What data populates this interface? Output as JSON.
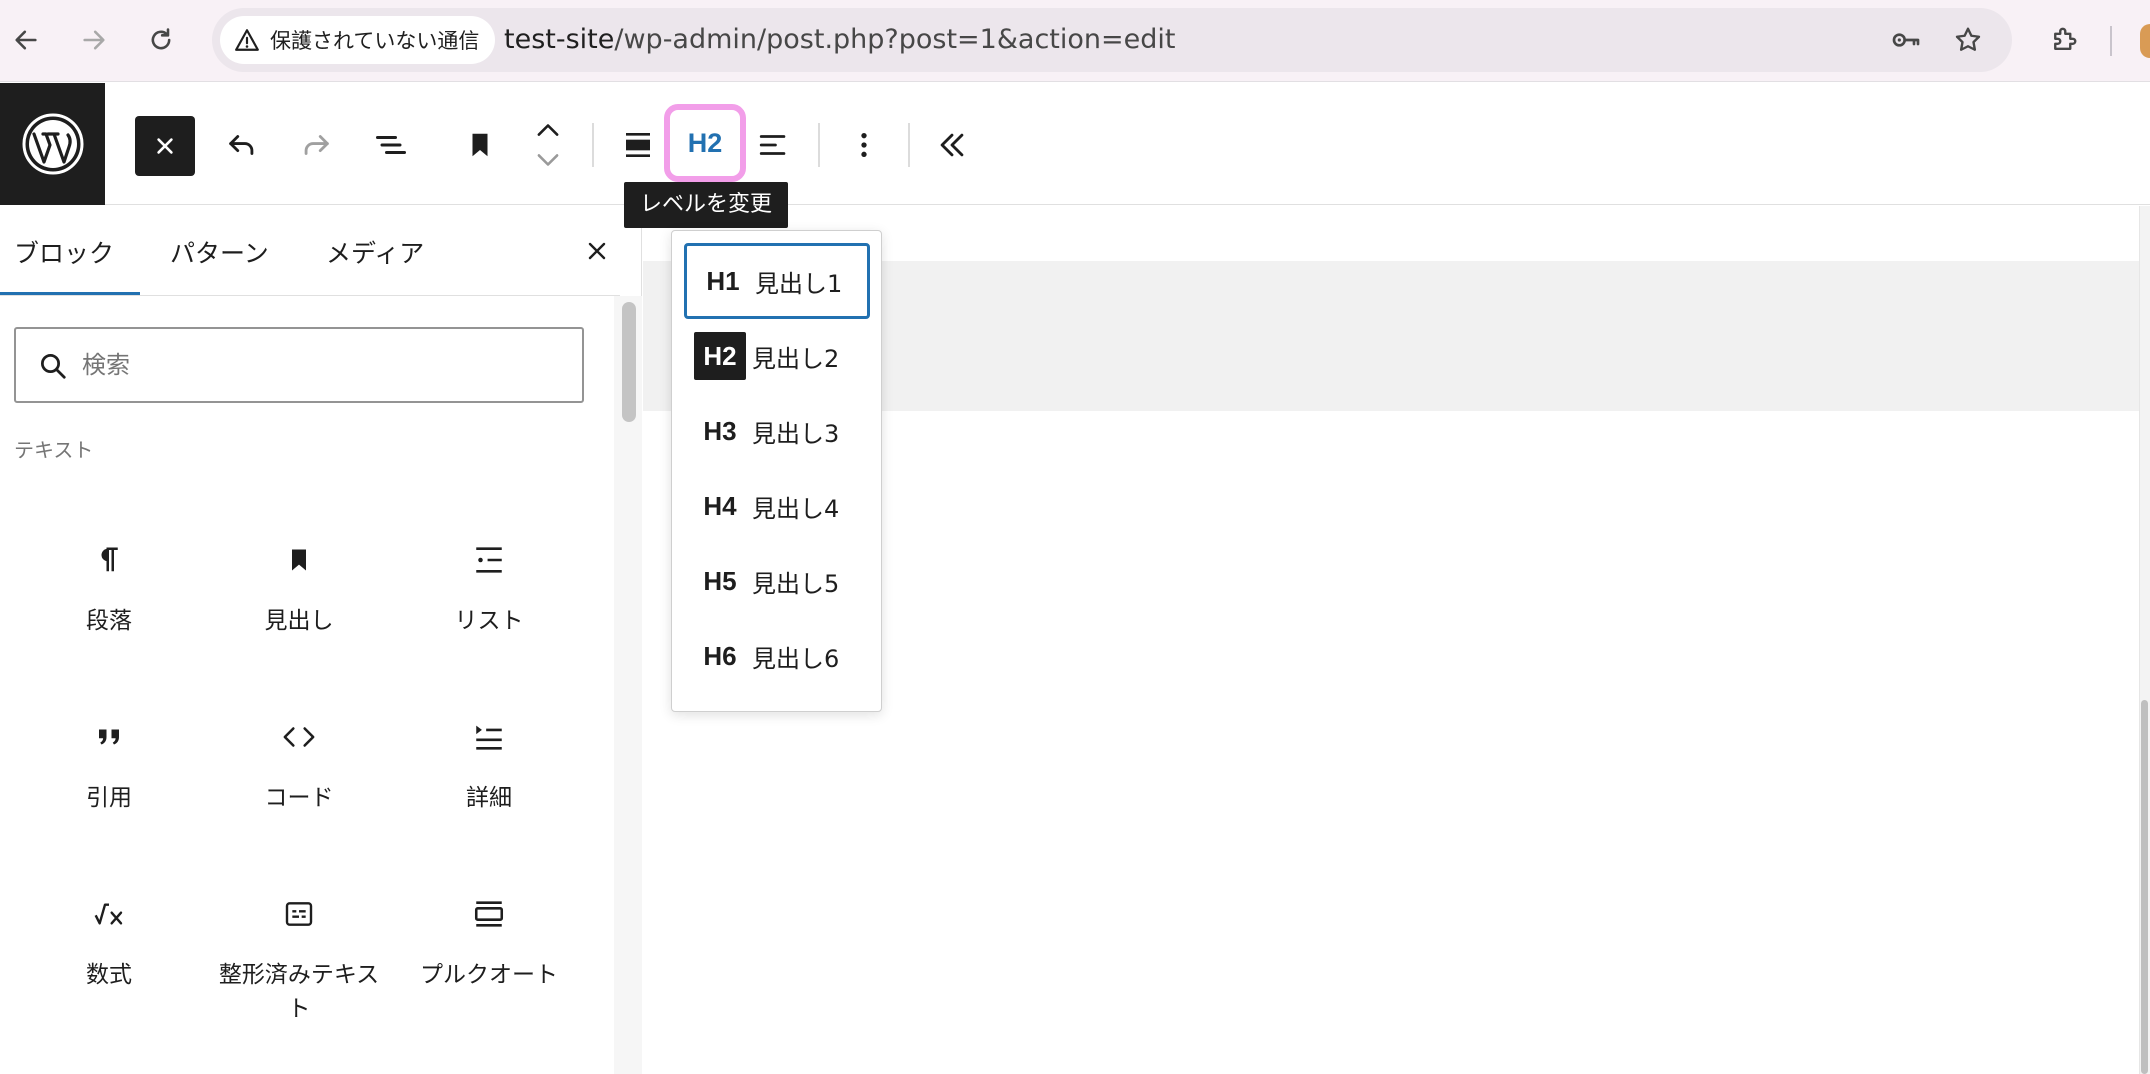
{
  "browser": {
    "security_label": "保護されていない通信",
    "url_host": "test-site",
    "url_path": "/wp-admin/post.php?post=1&action=edit"
  },
  "toolbar": {
    "heading_level_label": "H2",
    "tooltip": "レベルを変更"
  },
  "inserter": {
    "tabs": [
      {
        "label": "ブロック"
      },
      {
        "label": "パターン"
      },
      {
        "label": "メディア"
      }
    ],
    "search_placeholder": "検索",
    "category": "テキスト",
    "blocks": [
      {
        "label": "段落",
        "icon": "paragraph-icon"
      },
      {
        "label": "見出し",
        "icon": "heading-bookmark-icon"
      },
      {
        "label": "リスト",
        "icon": "list-icon"
      },
      {
        "label": "引用",
        "icon": "quote-icon"
      },
      {
        "label": "コード",
        "icon": "code-icon"
      },
      {
        "label": "詳細",
        "icon": "details-icon"
      },
      {
        "label": "数式",
        "icon": "math-icon"
      },
      {
        "label": "整形済みテキスト",
        "icon": "preformatted-icon"
      },
      {
        "label": "プルクオート",
        "icon": "pullquote-icon"
      }
    ]
  },
  "heading_dropdown": {
    "items": [
      {
        "level": "H1",
        "label": "見出し1"
      },
      {
        "level": "H2",
        "label": "見出し2"
      },
      {
        "level": "H3",
        "label": "見出し3"
      },
      {
        "level": "H4",
        "label": "見出し4"
      },
      {
        "level": "H5",
        "label": "見出し5"
      },
      {
        "level": "H6",
        "label": "見出し6"
      }
    ],
    "active_level": "H2",
    "focused_level": "H1"
  },
  "colors": {
    "accent": "#2271b1",
    "dark": "#1e1e1e",
    "highlight": "#f29ee9"
  }
}
